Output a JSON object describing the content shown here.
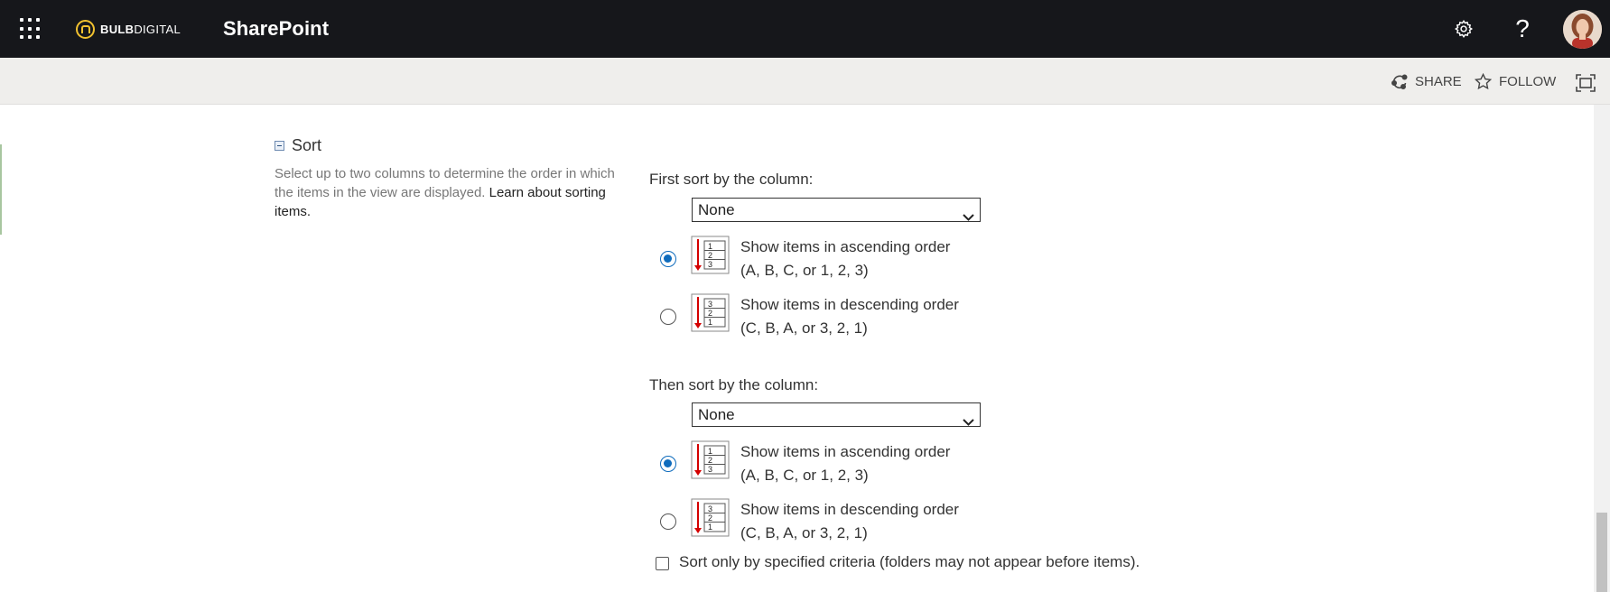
{
  "suite_bar": {
    "brand_bold": "BULB",
    "brand_light": "DIGITAL",
    "app_title": "SharePoint",
    "icons": [
      "waffle-icon",
      "gear-icon",
      "help-icon",
      "avatar"
    ],
    "help_glyph": "?"
  },
  "command_bar": {
    "share_label": "SHARE",
    "follow_label": "FOLLOW",
    "icons": [
      "share-icon",
      "star-icon",
      "focus-mode-icon"
    ]
  },
  "sort_section": {
    "title": "Sort",
    "description": "Select up to two columns to determine the order in which the items in the view are displayed.",
    "learn_link": "Learn about sorting items.",
    "first": {
      "label": "First sort by the column:",
      "selected": "None",
      "ascending": {
        "line1": "Show items in ascending order",
        "line2": "(A, B, C, or 1, 2, 3)",
        "checked": true
      },
      "descending": {
        "line1": "Show items in descending order",
        "line2": "(C, B, A, or 3, 2, 1)",
        "checked": false
      }
    },
    "second": {
      "label": "Then sort by the column:",
      "selected": "None",
      "ascending": {
        "line1": "Show items in ascending order",
        "line2": "(A, B, C, or 1, 2, 3)",
        "checked": true
      },
      "descending": {
        "line1": "Show items in descending order",
        "line2": "(C, B, A, or 3, 2, 1)",
        "checked": false
      }
    },
    "criteria_checkbox": {
      "label": "Sort only by specified criteria (folders may not appear before items).",
      "checked": false
    }
  },
  "colors": {
    "suite_bar_bg": "#16171b",
    "logo_accent": "#f2c230",
    "command_bar_bg": "#efeeec",
    "radio_accent": "#0f6cbd",
    "sort_arrow": "#d40000"
  }
}
